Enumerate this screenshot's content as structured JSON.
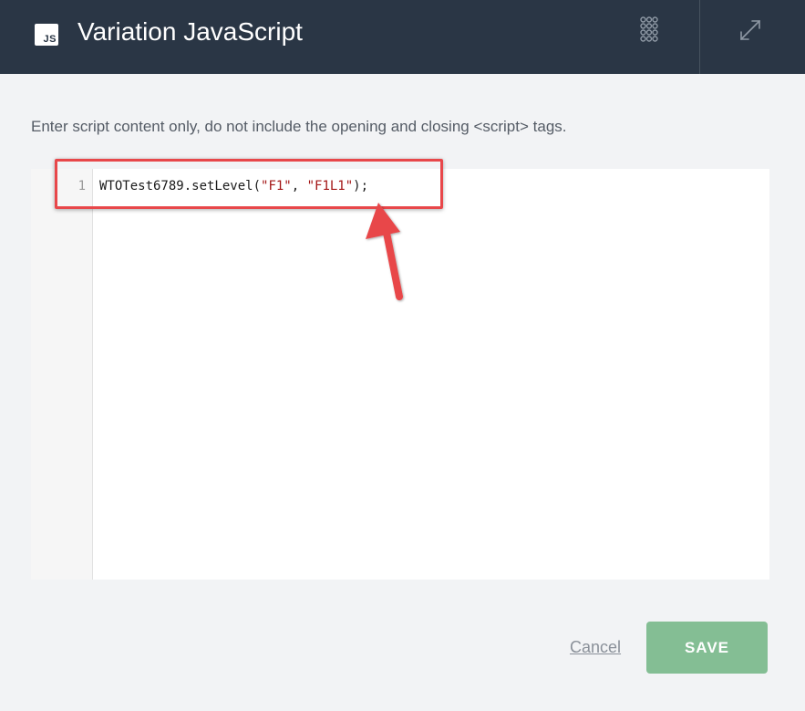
{
  "header": {
    "badge_text": "JS",
    "title": "Variation JavaScript",
    "grid_icon": "grid-dots-icon",
    "expand_icon": "expand-icon"
  },
  "instructions": "Enter script content only, do not include the opening and closing <script> tags.",
  "editor": {
    "line_number": "1",
    "code": {
      "prefix": "WTOTest6789.setLevel(",
      "arg1": "\"F1\"",
      "separator": ", ",
      "arg2": "\"F1L1\"",
      "suffix": ");"
    }
  },
  "footer": {
    "cancel_label": "Cancel",
    "save_label": "SAVE"
  },
  "colors": {
    "header_bg": "#2a3645",
    "save_bg": "#84be94",
    "highlight": "#e8474a",
    "string": "#a31515"
  }
}
